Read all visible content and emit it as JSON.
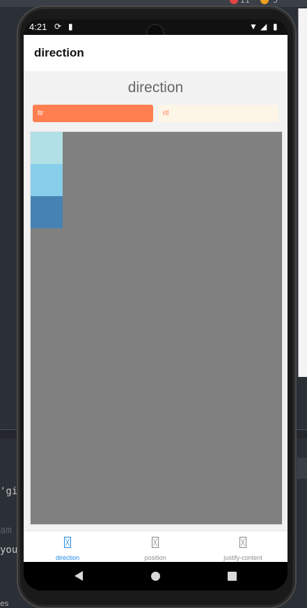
{
  "ide": {
    "code_lines": [
      "'gi",
      "am",
      "you"
    ],
    "status_text": "es",
    "top_counts": [
      "11",
      "5"
    ]
  },
  "statusbar": {
    "time": "4:21"
  },
  "appbar": {
    "title": "direction"
  },
  "main": {
    "heading": "direction",
    "options": [
      {
        "label": "ltr",
        "selected": true
      },
      {
        "label": "rtl",
        "selected": false
      }
    ],
    "boxes": [
      {
        "color": "#b0e0e6"
      },
      {
        "color": "#87ceeb"
      },
      {
        "color": "#4682b4"
      }
    ],
    "playground_color": "#808080",
    "accent_color": "#ff7f50"
  },
  "tabs": [
    {
      "label": "direction",
      "active": true,
      "icon": "placeholder-icon"
    },
    {
      "label": "position",
      "active": false,
      "icon": "placeholder-icon"
    },
    {
      "label": "justify-content",
      "active": false,
      "icon": "placeholder-icon"
    }
  ],
  "navbar": {
    "icons": [
      "back-icon",
      "home-icon",
      "recents-icon"
    ]
  }
}
